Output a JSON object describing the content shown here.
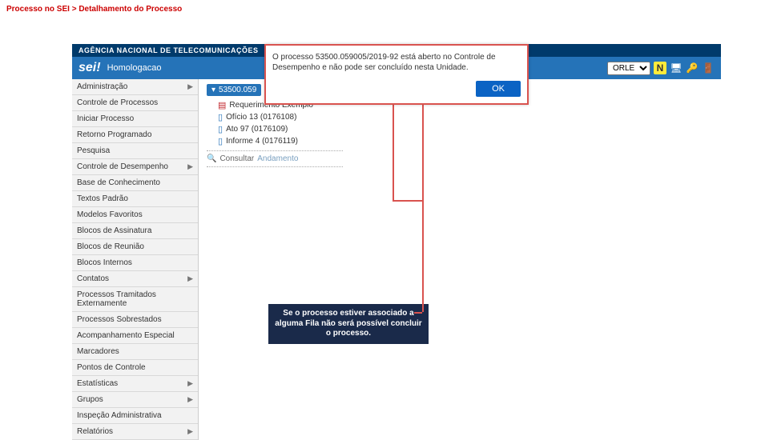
{
  "breadcrumb": "Processo no SEI > Detalhamento do Processo",
  "titlebar": "AGÊNCIA NACIONAL DE TELECOMUNICAÇÕES",
  "header": {
    "logo": "sei!",
    "env": "Homologacao",
    "unit": "ORLE"
  },
  "sidebar": [
    {
      "label": "Administração",
      "sub": true
    },
    {
      "label": "Controle de Processos",
      "sub": false
    },
    {
      "label": "Iniciar Processo",
      "sub": false
    },
    {
      "label": "Retorno Programado",
      "sub": false
    },
    {
      "label": "Pesquisa",
      "sub": false
    },
    {
      "label": "Controle de Desempenho",
      "sub": true
    },
    {
      "label": "Base de Conhecimento",
      "sub": false
    },
    {
      "label": "Textos Padrão",
      "sub": false
    },
    {
      "label": "Modelos Favoritos",
      "sub": false
    },
    {
      "label": "Blocos de Assinatura",
      "sub": false
    },
    {
      "label": "Blocos de Reunião",
      "sub": false
    },
    {
      "label": "Blocos Internos",
      "sub": false
    },
    {
      "label": "Contatos",
      "sub": true
    },
    {
      "label": "Processos Tramitados Externamente",
      "sub": false
    },
    {
      "label": "Processos Sobrestados",
      "sub": false
    },
    {
      "label": "Acompanhamento Especial",
      "sub": false
    },
    {
      "label": "Marcadores",
      "sub": false
    },
    {
      "label": "Pontos de Controle",
      "sub": false
    },
    {
      "label": "Estatísticas",
      "sub": true
    },
    {
      "label": "Grupos",
      "sub": true
    },
    {
      "label": "Inspeção Administrativa",
      "sub": false
    },
    {
      "label": "Relatórios",
      "sub": true
    }
  ],
  "process": {
    "number": "53500.059"
  },
  "docs": [
    {
      "icon": "pdf",
      "label": "Requerimento Exemplo"
    },
    {
      "icon": "doc",
      "label": "Ofício 13 (0176108)"
    },
    {
      "icon": "doc",
      "label": "Ato 97 (0176109)"
    },
    {
      "icon": "doc",
      "label": "Informe 4 (0176119)"
    }
  ],
  "consult": {
    "prefix": "Consultar",
    "link": "Andamento"
  },
  "modal": {
    "text": "O processo 53500.059005/2019-92 está aberto no Controle de Desempenho e não pode ser concluído nesta Unidade.",
    "ok": "OK"
  },
  "callout": "Se o processo estiver associado a alguma Fila não será possível concluir o processo.",
  "icons": {
    "postit": "N",
    "monitor": "🖥",
    "key": "🔑",
    "exit": "🚪"
  }
}
